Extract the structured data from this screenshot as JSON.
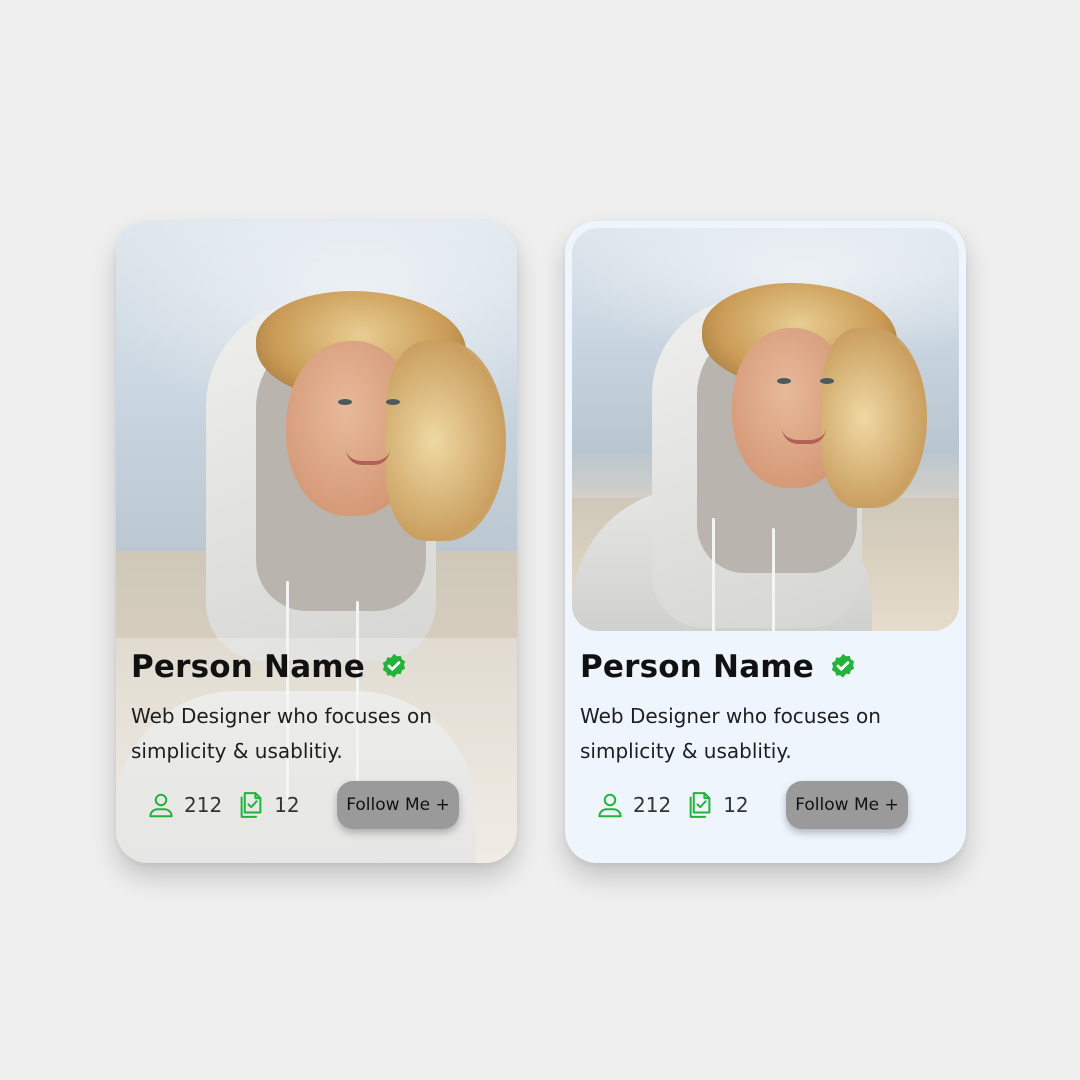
{
  "cards": [
    {
      "variant": "full-image",
      "name": "Person Name",
      "description": "Web Designer who focuses on simplicity & usablitiy.",
      "followers": "212",
      "projects": "12",
      "follow_label": "Follow Me +"
    },
    {
      "variant": "framed-image",
      "name": "Person Name",
      "description": "Web Designer who focuses on simplicity & usablitiy.",
      "followers": "212",
      "projects": "12",
      "follow_label": "Follow Me +"
    }
  ],
  "icons": {
    "verified": "verified-badge-icon",
    "followers": "user-icon",
    "projects": "documents-check-icon"
  },
  "colors": {
    "accent_green": "#22b33a",
    "page_background": "#efefef",
    "card_b_background": "#eef5fd",
    "follow_button": "#9a9a9a"
  }
}
